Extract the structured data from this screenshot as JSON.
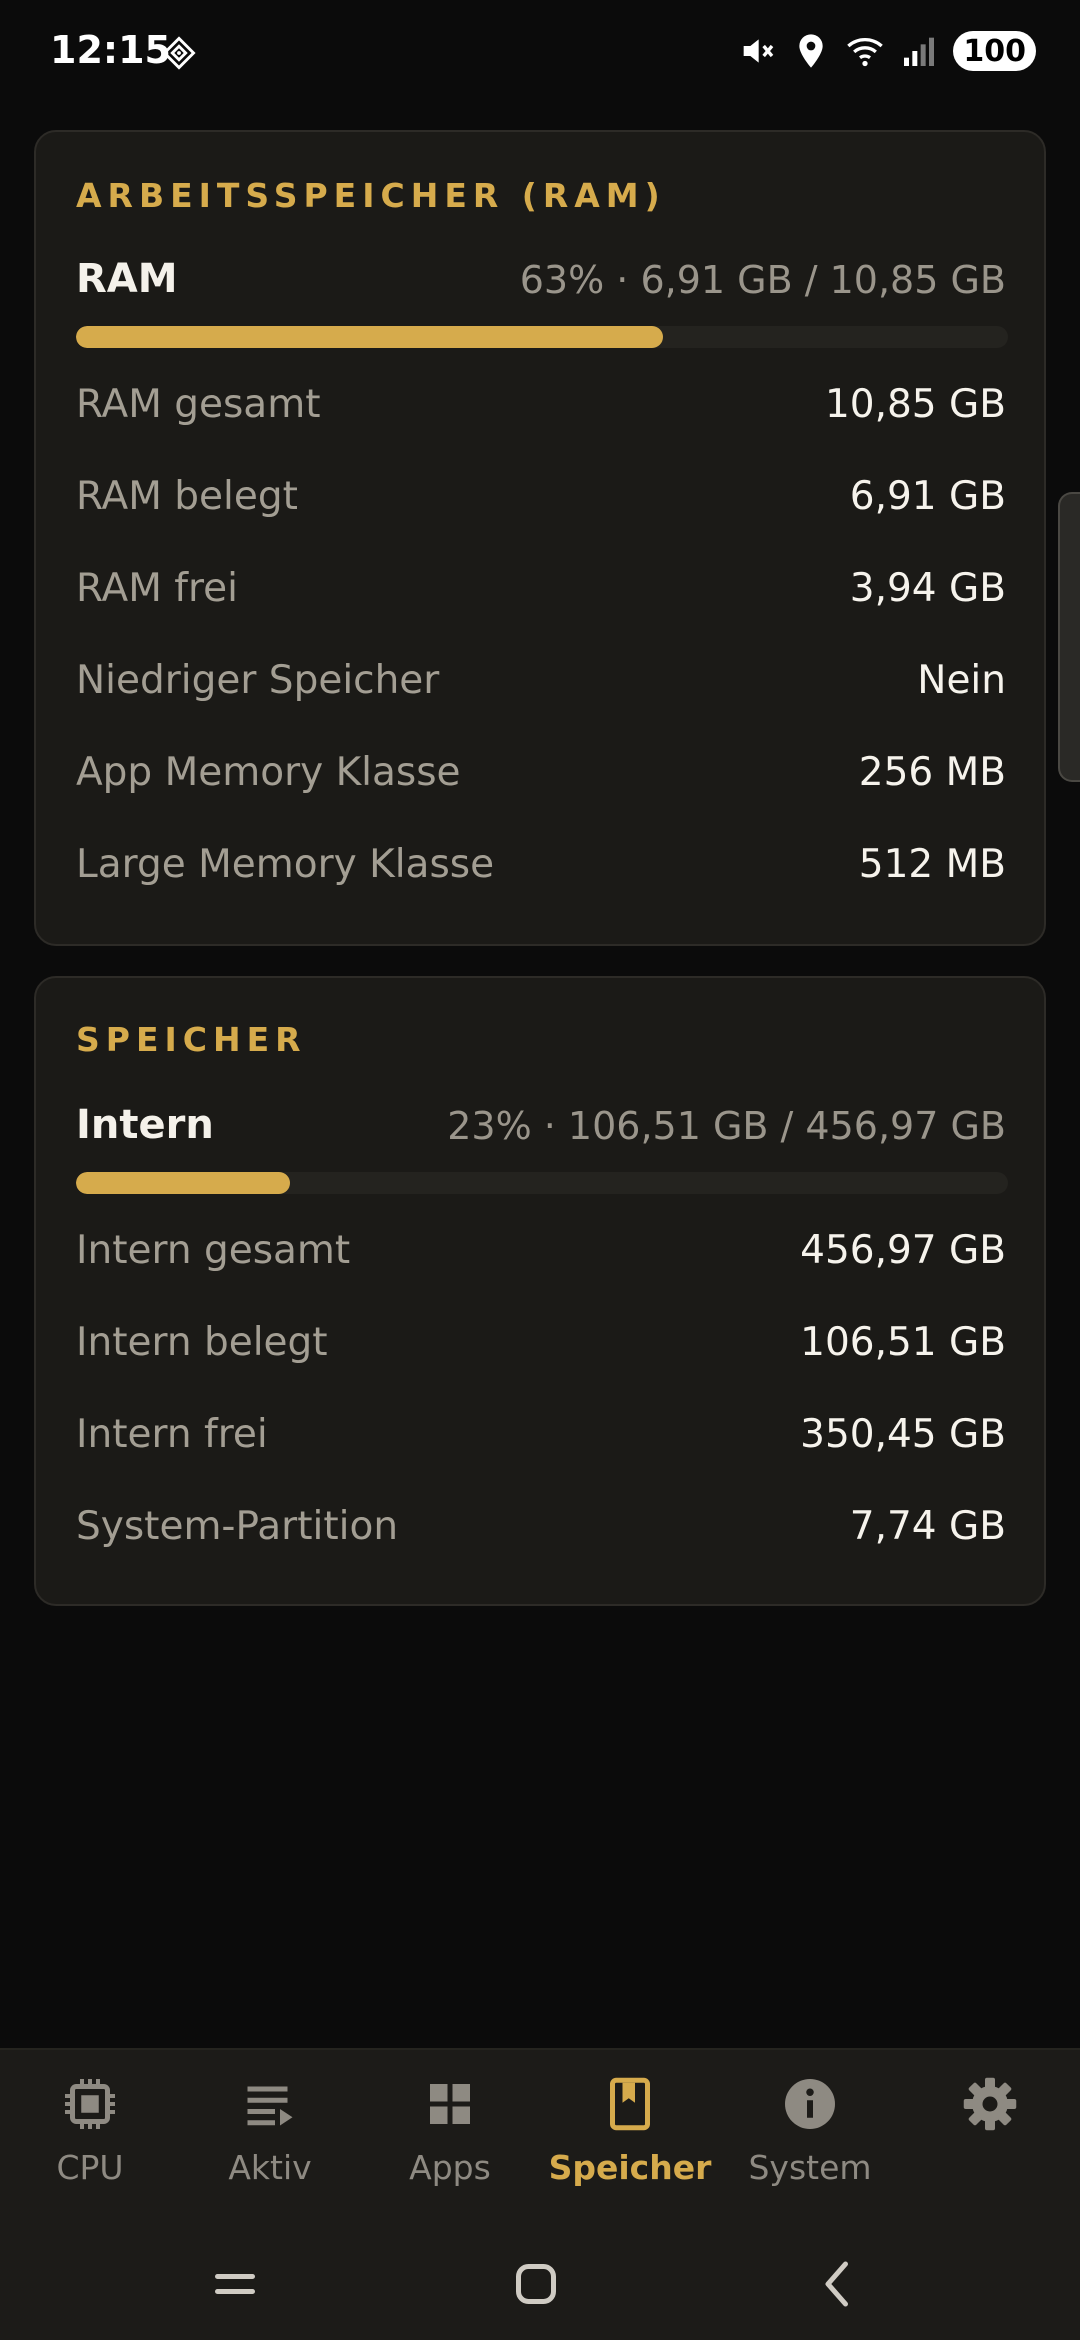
{
  "status_bar": {
    "time": "12:15",
    "battery": "100",
    "icons": [
      "sync-icon",
      "mute-icon",
      "location-icon",
      "wifi-icon",
      "signal-icon"
    ]
  },
  "ram": {
    "title": "ARBEITSSPEICHER (RAM)",
    "usage_label": "RAM",
    "usage_summary": "63% · 6,91 GB / 10,85 GB",
    "usage_percent": 63,
    "rows": [
      {
        "label": "RAM gesamt",
        "value": "10,85 GB"
      },
      {
        "label": "RAM belegt",
        "value": "6,91 GB"
      },
      {
        "label": "RAM frei",
        "value": "3,94 GB"
      },
      {
        "label": "Niedriger Speicher",
        "value": "Nein"
      },
      {
        "label": "App Memory Klasse",
        "value": "256 MB"
      },
      {
        "label": "Large Memory Klasse",
        "value": "512 MB"
      }
    ]
  },
  "storage": {
    "title": "SPEICHER",
    "usage_label": "Intern",
    "usage_summary": "23% · 106,51 GB / 456,97 GB",
    "usage_percent": 23,
    "rows": [
      {
        "label": "Intern gesamt",
        "value": "456,97 GB"
      },
      {
        "label": "Intern belegt",
        "value": "106,51 GB"
      },
      {
        "label": "Intern frei",
        "value": "350,45 GB"
      },
      {
        "label": "System-Partition",
        "value": "7,74 GB"
      }
    ]
  },
  "bottom_nav": {
    "active": "Speicher",
    "items": [
      {
        "label": "CPU",
        "icon": "cpu-icon"
      },
      {
        "label": "Aktiv",
        "icon": "list-icon"
      },
      {
        "label": "Apps",
        "icon": "grid-icon"
      },
      {
        "label": "Speicher",
        "icon": "storage-icon"
      },
      {
        "label": "System",
        "icon": "info-icon"
      },
      {
        "label": "",
        "icon": "gear-icon"
      }
    ]
  },
  "colors": {
    "accent": "#d6ab4c",
    "background": "#0b0b0b",
    "card": "#1b1a17",
    "muted": "#a39e93"
  }
}
